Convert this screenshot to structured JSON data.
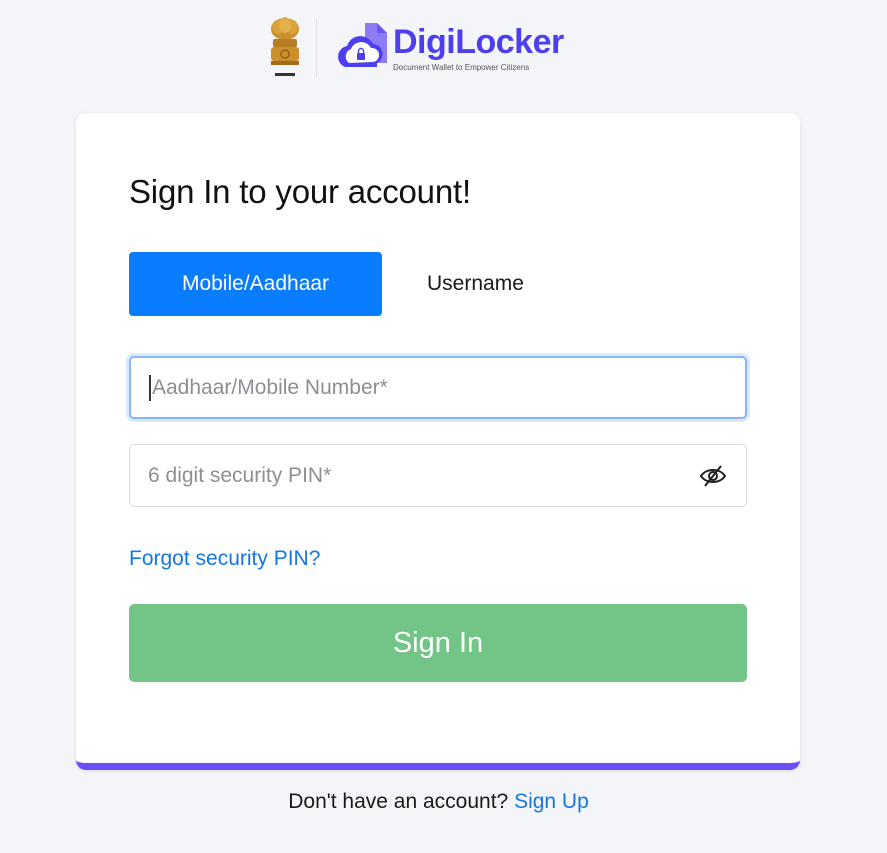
{
  "header": {
    "emblem_caption": "सत्यमेव जयते",
    "brand_name": "DigiLocker",
    "tagline": "Document Wallet to Empower Citizens"
  },
  "login": {
    "title": "Sign In to your account!",
    "tabs": [
      {
        "label": "Mobile/Aadhaar",
        "active": true
      },
      {
        "label": "Username",
        "active": false
      }
    ],
    "mobile_field": {
      "placeholder": "Aadhaar/Mobile Number*",
      "value": ""
    },
    "pin_field": {
      "placeholder": "6 digit security PIN*",
      "value": ""
    },
    "forgot_label": "Forgot security PIN?",
    "signin_label": "Sign In"
  },
  "footer": {
    "prompt": "Don't have an account?",
    "signup_label": "Sign Up"
  },
  "colors": {
    "primary": "#0a7cff",
    "brand": "#4d3ff0",
    "signin_button": "#72c587",
    "card_accent": "#6c4df6",
    "link": "#1477e6"
  },
  "icons": {
    "emblem": "state-emblem-icon",
    "brand_mark": "digilocker-cloud-icon",
    "pin_visibility": "eye-slash-icon"
  }
}
